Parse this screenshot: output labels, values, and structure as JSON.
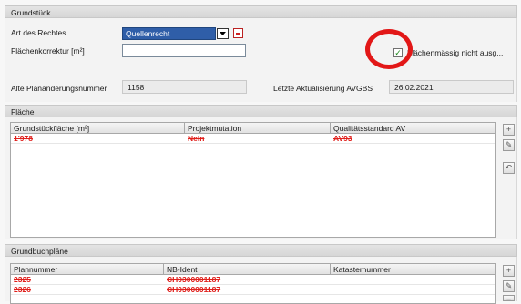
{
  "grundstueck": {
    "title": "Grundstück",
    "art_label": "Art des Rechtes",
    "art_value": "Quellenrecht",
    "flaeche_label": "Flächenkorrektur [m²]",
    "flaeche_value": "",
    "checkbox_label": "Flächenmässig nicht ausg...",
    "checkbox_checked": true,
    "plan_label": "Alte Planänderungsnummer",
    "plan_value": "1158",
    "update_label": "Letzte Aktualisierung AVGBS",
    "update_value": "26.02.2021"
  },
  "flaeche": {
    "title": "Fläche",
    "columns": [
      "Grundstückfläche [m²]",
      "Projektmutation",
      "Qualitätsstandard AV"
    ],
    "rows": [
      [
        "1'978",
        "Nein",
        "AV93"
      ]
    ]
  },
  "grundbuch": {
    "title": "Grundbuchpläne",
    "columns": [
      "Plannummer",
      "NB-Ident",
      "Katasternummer"
    ],
    "rows": [
      [
        "2325",
        "CH0300001187",
        ""
      ],
      [
        "2326",
        "CH0300001187",
        ""
      ]
    ]
  },
  "colors": {
    "strike_red": "#e0201c",
    "annotation_red": "#e21717",
    "combo_blue": "#2f5ea8"
  }
}
